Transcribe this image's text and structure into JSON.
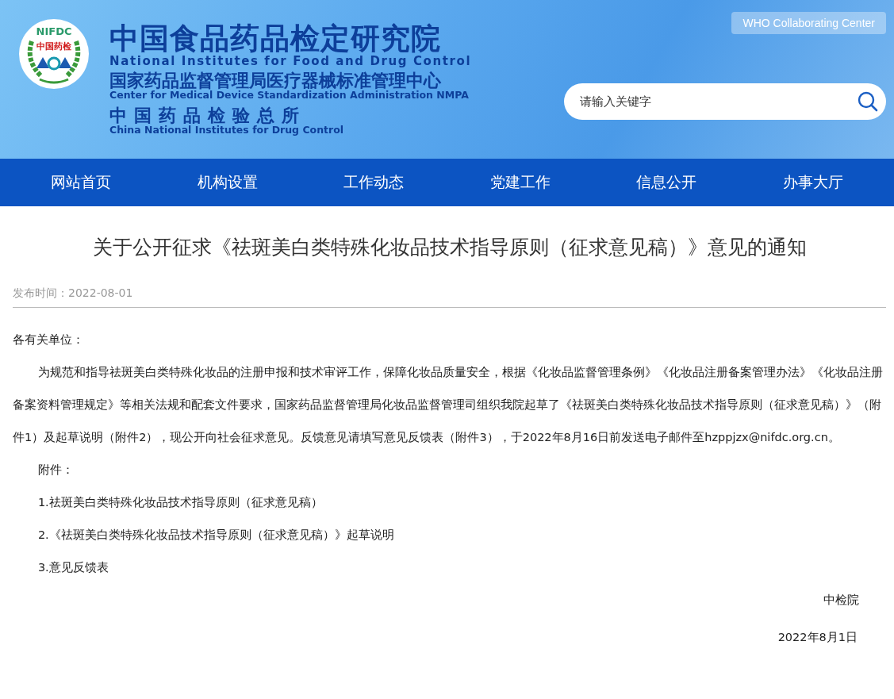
{
  "header": {
    "logo": {
      "ring_text": "NIFDC",
      "badge_text": "中国药检"
    },
    "titles": [
      {
        "kind": "big",
        "text": "中国食品药品检定研究院"
      },
      {
        "kind": "en-wide",
        "text": "National Institutes for Food and Drug Control"
      },
      {
        "kind": "mid",
        "text": "国家药品监督管理局医疗器械标准管理中心"
      },
      {
        "kind": "en",
        "text": "Center for Medical Device Standardization Administration NMPA"
      },
      {
        "kind": "mid-spaced",
        "text": "中国药品检验总所"
      },
      {
        "kind": "en",
        "text": "China National Institutes for Drug Control"
      }
    ],
    "who_badge": "WHO Collaborating Center",
    "search": {
      "placeholder": "请输入关键字"
    }
  },
  "nav": [
    {
      "label": "网站首页"
    },
    {
      "label": "机构设置"
    },
    {
      "label": "工作动态"
    },
    {
      "label": "党建工作"
    },
    {
      "label": "信息公开"
    },
    {
      "label": "办事大厅"
    }
  ],
  "article": {
    "title": "关于公开征求《祛斑美白类特殊化妆品技术指导原则（征求意见稿）》意见的通知",
    "publish_label": "发布时间：",
    "publish_date": "2022-08-01",
    "paragraphs": [
      {
        "kind": "plain",
        "text": "各有关单位："
      },
      {
        "kind": "indent",
        "text": "为规范和指导祛斑美白类特殊化妆品的注册申报和技术审评工作，保障化妆品质量安全，根据《化妆品监督管理条例》《化妆品注册备案管理办法》《化妆品注册备案资料管理规定》等相关法规和配套文件要求，国家药品监督管理局化妆品监督管理司组织我院起草了《祛斑美白类特殊化妆品技术指导原则（征求意见稿）》（附件1）及起草说明（附件2），现公开向社会征求意见。反馈意见请填写意见反馈表（附件3），于2022年8月16日前发送电子邮件至hzppjzx@nifdc.org.cn。"
      },
      {
        "kind": "indent",
        "text": "附件："
      },
      {
        "kind": "indent",
        "text": "1.祛斑美白类特殊化妆品技术指导原则（征求意见稿）"
      },
      {
        "kind": "indent",
        "text": "2.《祛斑美白类特殊化妆品技术指导原则（征求意见稿）》起草说明"
      },
      {
        "kind": "indent",
        "text": "3.意见反馈表"
      },
      {
        "kind": "sign",
        "text": "中检院"
      },
      {
        "kind": "date",
        "text": "2022年8月1日"
      }
    ]
  }
}
